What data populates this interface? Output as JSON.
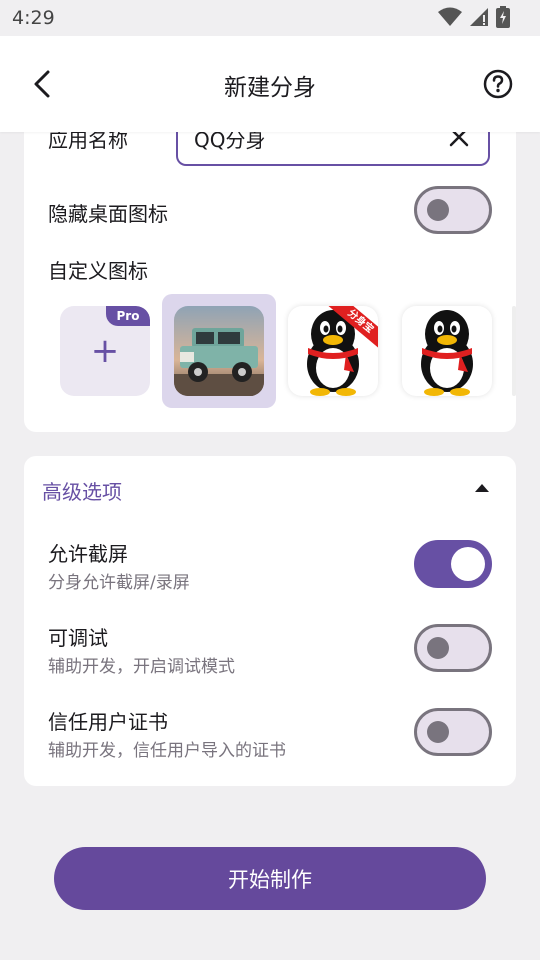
{
  "status": {
    "time": "4:29"
  },
  "appbar": {
    "title": "新建分身"
  },
  "form": {
    "name_label": "应用名称",
    "name_value": "QQ分身",
    "hide_icon_label": "隐藏桌面图标",
    "hide_icon_on": false,
    "custom_icon_label": "自定义图标",
    "pro_badge": "Pro",
    "add_symbol": "+",
    "qq_ribbon": "分身宝"
  },
  "advanced": {
    "title": "高级选项",
    "options": [
      {
        "title": "允许截屏",
        "subtitle": "分身允许截屏/录屏",
        "on": true
      },
      {
        "title": "可调试",
        "subtitle": "辅助开发，开启调试模式",
        "on": false
      },
      {
        "title": "信任用户证书",
        "subtitle": "辅助开发，信任用户导入的证书",
        "on": false
      }
    ]
  },
  "actions": {
    "start_label": "开始制作"
  },
  "colors": {
    "accent": "#6750a4",
    "button": "#65499c",
    "background": "#f0eff1"
  }
}
